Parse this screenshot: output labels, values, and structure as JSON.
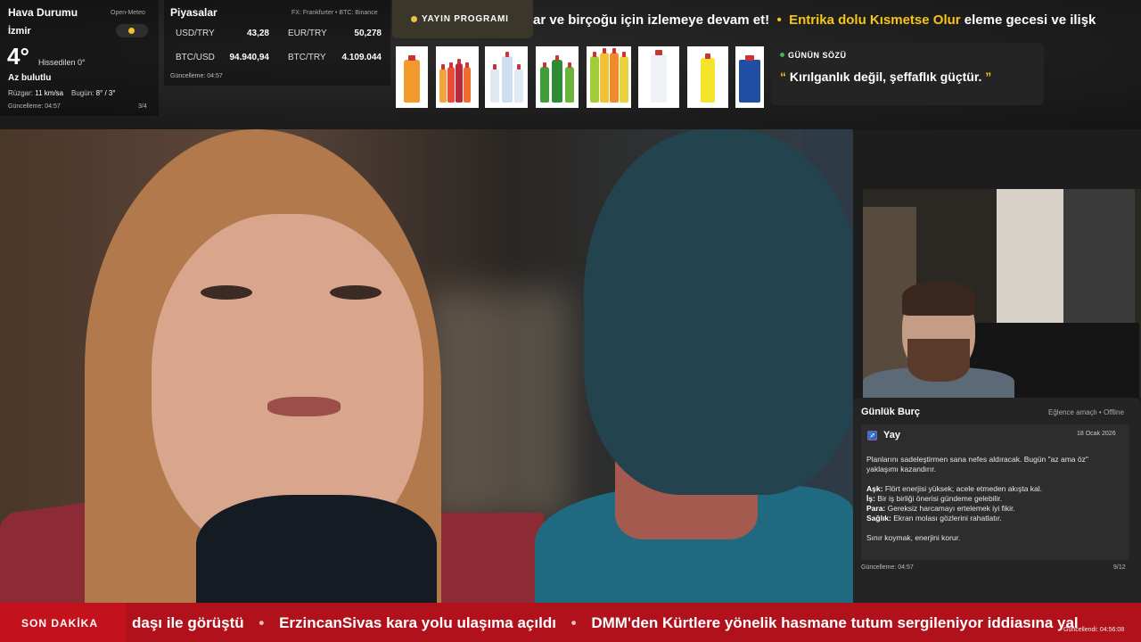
{
  "weather": {
    "title": "Hava Durumu",
    "source": "Open-Meteo",
    "city": "İzmir",
    "temperature": "4°",
    "feels_like": "Hissedilen 0°",
    "condition": "Az bulutlu",
    "wind_label": "Rüzgar:",
    "wind_value": "11 km/sa",
    "today_label": "Bugün:",
    "today_value": "8° / 3°",
    "updated": "Güncelleme: 04:57",
    "page": "3/4",
    "icon": "partly-cloudy-icon"
  },
  "markets": {
    "title": "Piyasalar",
    "source": "FX: Frankfurter • BTC: Binance",
    "rows": [
      {
        "label": "USD/TRY",
        "value": "43,28"
      },
      {
        "label": "EUR/TRY",
        "value": "50,278"
      },
      {
        "label": "BTC/USD",
        "value": "94.940,94"
      },
      {
        "label": "BTC/TRY",
        "value": "4.109.044"
      }
    ],
    "updated": "Güncelleme: 04:57"
  },
  "schedule": {
    "label": "YAYIN PROGRAMI"
  },
  "top_ticker": {
    "part1": "ar ve birçoğu için izlemeye devam et!",
    "separator": "•",
    "highlight": "Entrika dolu Kısmetse Olur",
    "part2": "eleme gecesi ve ilişk"
  },
  "quote": {
    "title": "GÜNÜN SÖZÜ",
    "open_mark": "“",
    "text": "Kırılganlık değil, şeffaflık güçtür.",
    "close_mark": "”"
  },
  "horoscope": {
    "title": "Günlük Burç",
    "meta": "Eğlence amaçlı • Offline",
    "sign_icon": "♐",
    "sign": "Yay",
    "date": "18 Ocak 2026",
    "intro_line1": "Planlarını sadeleştirmen sana nefes aldıracak. Bugün \"az ama öz\"",
    "intro_line2": "yaklaşımı kazandırır.",
    "love_label": "Aşk:",
    "love_text": "Flört enerjisi yüksek; acele etmeden akışta kal.",
    "work_label": "İş:",
    "work_text": "Bir iş birliği önerisi gündeme gelebilir.",
    "money_label": "Para:",
    "money_text": "Gereksiz harcamayı ertelemek iyi fikir.",
    "health_label": "Sağlık:",
    "health_text": "Ekran molası gözlerini rahatlatır.",
    "advice": "Sınır koymak, enerjini korur.",
    "updated": "Güncelleme: 04:57",
    "page": "9/12"
  },
  "breaking": {
    "label": "SON DAKİKA",
    "item1": "daşı ile görüştü",
    "separator": "•",
    "item2": "ErzincanSivas kara yolu ulaşıma açıldı",
    "item3": "DMM'den Kürtlere yönelik hasmane tutum sergileniyor iddiasına yal",
    "updated": "Güncellendi: 04:56:08"
  },
  "colors": {
    "accent": "#f5c518",
    "breaking_red": "#b0111b",
    "panel": "#242424"
  }
}
